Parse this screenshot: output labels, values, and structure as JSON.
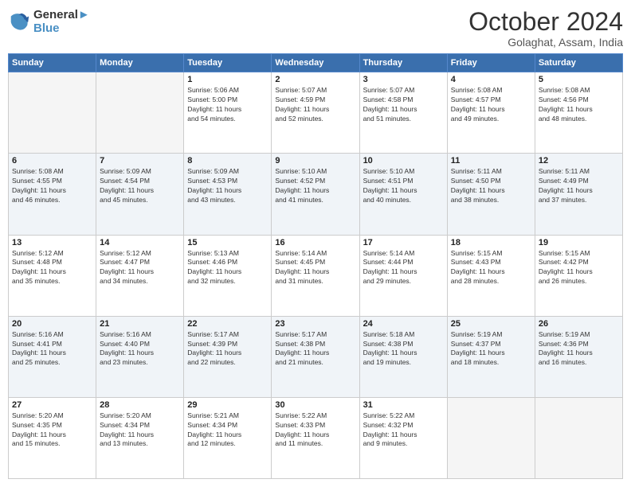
{
  "logo": {
    "line1": "General",
    "line2": "Blue"
  },
  "title": "October 2024",
  "location": "Golaghat, Assam, India",
  "days_of_week": [
    "Sunday",
    "Monday",
    "Tuesday",
    "Wednesday",
    "Thursday",
    "Friday",
    "Saturday"
  ],
  "weeks": [
    [
      {
        "day": "",
        "info": ""
      },
      {
        "day": "",
        "info": ""
      },
      {
        "day": "1",
        "info": "Sunrise: 5:06 AM\nSunset: 5:00 PM\nDaylight: 11 hours\nand 54 minutes."
      },
      {
        "day": "2",
        "info": "Sunrise: 5:07 AM\nSunset: 4:59 PM\nDaylight: 11 hours\nand 52 minutes."
      },
      {
        "day": "3",
        "info": "Sunrise: 5:07 AM\nSunset: 4:58 PM\nDaylight: 11 hours\nand 51 minutes."
      },
      {
        "day": "4",
        "info": "Sunrise: 5:08 AM\nSunset: 4:57 PM\nDaylight: 11 hours\nand 49 minutes."
      },
      {
        "day": "5",
        "info": "Sunrise: 5:08 AM\nSunset: 4:56 PM\nDaylight: 11 hours\nand 48 minutes."
      }
    ],
    [
      {
        "day": "6",
        "info": "Sunrise: 5:08 AM\nSunset: 4:55 PM\nDaylight: 11 hours\nand 46 minutes."
      },
      {
        "day": "7",
        "info": "Sunrise: 5:09 AM\nSunset: 4:54 PM\nDaylight: 11 hours\nand 45 minutes."
      },
      {
        "day": "8",
        "info": "Sunrise: 5:09 AM\nSunset: 4:53 PM\nDaylight: 11 hours\nand 43 minutes."
      },
      {
        "day": "9",
        "info": "Sunrise: 5:10 AM\nSunset: 4:52 PM\nDaylight: 11 hours\nand 41 minutes."
      },
      {
        "day": "10",
        "info": "Sunrise: 5:10 AM\nSunset: 4:51 PM\nDaylight: 11 hours\nand 40 minutes."
      },
      {
        "day": "11",
        "info": "Sunrise: 5:11 AM\nSunset: 4:50 PM\nDaylight: 11 hours\nand 38 minutes."
      },
      {
        "day": "12",
        "info": "Sunrise: 5:11 AM\nSunset: 4:49 PM\nDaylight: 11 hours\nand 37 minutes."
      }
    ],
    [
      {
        "day": "13",
        "info": "Sunrise: 5:12 AM\nSunset: 4:48 PM\nDaylight: 11 hours\nand 35 minutes."
      },
      {
        "day": "14",
        "info": "Sunrise: 5:12 AM\nSunset: 4:47 PM\nDaylight: 11 hours\nand 34 minutes."
      },
      {
        "day": "15",
        "info": "Sunrise: 5:13 AM\nSunset: 4:46 PM\nDaylight: 11 hours\nand 32 minutes."
      },
      {
        "day": "16",
        "info": "Sunrise: 5:14 AM\nSunset: 4:45 PM\nDaylight: 11 hours\nand 31 minutes."
      },
      {
        "day": "17",
        "info": "Sunrise: 5:14 AM\nSunset: 4:44 PM\nDaylight: 11 hours\nand 29 minutes."
      },
      {
        "day": "18",
        "info": "Sunrise: 5:15 AM\nSunset: 4:43 PM\nDaylight: 11 hours\nand 28 minutes."
      },
      {
        "day": "19",
        "info": "Sunrise: 5:15 AM\nSunset: 4:42 PM\nDaylight: 11 hours\nand 26 minutes."
      }
    ],
    [
      {
        "day": "20",
        "info": "Sunrise: 5:16 AM\nSunset: 4:41 PM\nDaylight: 11 hours\nand 25 minutes."
      },
      {
        "day": "21",
        "info": "Sunrise: 5:16 AM\nSunset: 4:40 PM\nDaylight: 11 hours\nand 23 minutes."
      },
      {
        "day": "22",
        "info": "Sunrise: 5:17 AM\nSunset: 4:39 PM\nDaylight: 11 hours\nand 22 minutes."
      },
      {
        "day": "23",
        "info": "Sunrise: 5:17 AM\nSunset: 4:38 PM\nDaylight: 11 hours\nand 21 minutes."
      },
      {
        "day": "24",
        "info": "Sunrise: 5:18 AM\nSunset: 4:38 PM\nDaylight: 11 hours\nand 19 minutes."
      },
      {
        "day": "25",
        "info": "Sunrise: 5:19 AM\nSunset: 4:37 PM\nDaylight: 11 hours\nand 18 minutes."
      },
      {
        "day": "26",
        "info": "Sunrise: 5:19 AM\nSunset: 4:36 PM\nDaylight: 11 hours\nand 16 minutes."
      }
    ],
    [
      {
        "day": "27",
        "info": "Sunrise: 5:20 AM\nSunset: 4:35 PM\nDaylight: 11 hours\nand 15 minutes."
      },
      {
        "day": "28",
        "info": "Sunrise: 5:20 AM\nSunset: 4:34 PM\nDaylight: 11 hours\nand 13 minutes."
      },
      {
        "day": "29",
        "info": "Sunrise: 5:21 AM\nSunset: 4:34 PM\nDaylight: 11 hours\nand 12 minutes."
      },
      {
        "day": "30",
        "info": "Sunrise: 5:22 AM\nSunset: 4:33 PM\nDaylight: 11 hours\nand 11 minutes."
      },
      {
        "day": "31",
        "info": "Sunrise: 5:22 AM\nSunset: 4:32 PM\nDaylight: 11 hours\nand 9 minutes."
      },
      {
        "day": "",
        "info": ""
      },
      {
        "day": "",
        "info": ""
      }
    ]
  ]
}
